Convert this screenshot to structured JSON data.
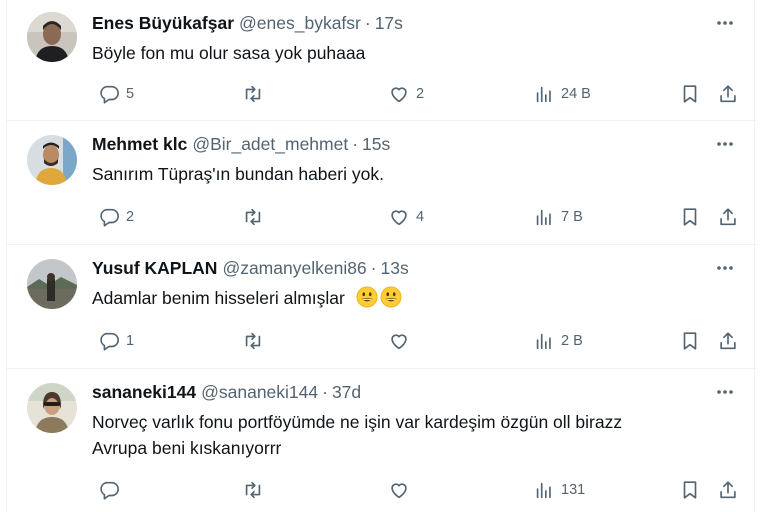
{
  "tweets": [
    {
      "name": "Enes Büyükafşar",
      "handle": "@enes_bykafsr",
      "dot": "·",
      "time": "17s",
      "text_lines": [
        "Böyle fon mu olur sasa yok puhaaa"
      ],
      "replies": "5",
      "retweets": "",
      "likes": "2",
      "views": "24 B"
    },
    {
      "name": "Mehmet klc",
      "handle": "@Bir_adet_mehmet",
      "dot": "·",
      "time": "15s",
      "text_lines": [
        "Sanırım Tüpraş'ın bundan haberi yok."
      ],
      "replies": "2",
      "retweets": "",
      "likes": "4",
      "views": "7 B"
    },
    {
      "name": "Yusuf KAPLAN",
      "handle": "@zamanyelkeni86",
      "dot": "·",
      "time": "13s",
      "text_lines": [
        "Adamlar benim hisseleri almışlar"
      ],
      "emoji": "grinning-face-emoji",
      "replies": "1",
      "retweets": "",
      "likes": "",
      "views": "2 B"
    },
    {
      "name": "sananeki144",
      "handle": "@sananeki144",
      "dot": "·",
      "time": "37d",
      "text_lines": [
        "Norveç varlık fonu portföyümde ne işin var kardeşim özgün oll birazz",
        "Avrupa beni kıskanıyorrr"
      ],
      "replies": "",
      "retweets": "",
      "likes": "",
      "views": "131"
    }
  ],
  "colors": {
    "text": "#0f1419",
    "secondary": "#536471",
    "border": "#eff3f4"
  },
  "icons": [
    "reply-icon",
    "retweet-icon",
    "like-icon",
    "views-icon",
    "bookmark-icon",
    "share-icon",
    "more-icon"
  ]
}
